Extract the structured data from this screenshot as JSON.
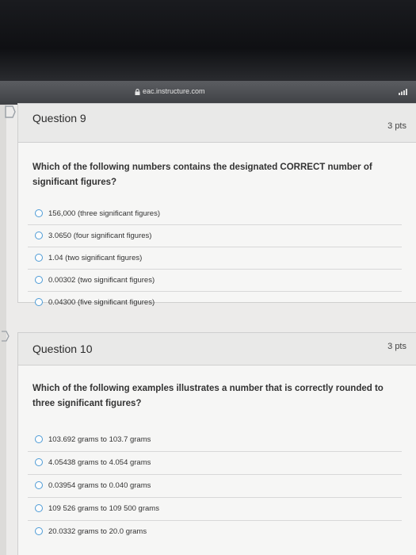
{
  "browser": {
    "url": "eac.instructure.com"
  },
  "questions": [
    {
      "title": "Question 9",
      "points": "3 pts",
      "text": "Which of the following numbers contains the designated CORRECT number of significant figures?",
      "answers": [
        "156,000 (three significant figures)",
        "3.0650 (four significant figures)",
        "1.04 (two significant figures)",
        "0.00302 (two significant figures)",
        "0.04300 (five significant figures)"
      ]
    },
    {
      "title": "Question 10",
      "points": "3 pts",
      "text": "Which of the following examples illustrates a number that is correctly rounded to three significant figures?",
      "answers": [
        "103.692 grams to 103.7 grams",
        "4.05438 grams to 4.054 grams",
        "0.03954 grams to 0.040 grams",
        "109 526 grams to 109 500 grams",
        "20.0332 grams to 20.0 grams"
      ]
    }
  ]
}
